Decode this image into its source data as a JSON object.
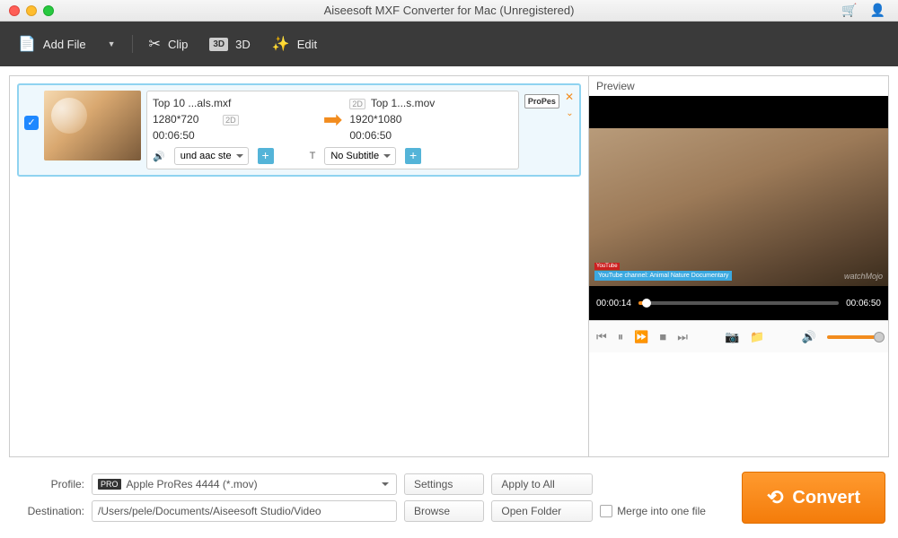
{
  "window": {
    "title": "Aiseesoft MXF Converter for Mac (Unregistered)"
  },
  "toolbar": {
    "add_file": "Add File",
    "clip": "Clip",
    "three_d": "3D",
    "three_d_badge": "3D",
    "edit": "Edit"
  },
  "file": {
    "source": {
      "name": "Top 10 ...als.mxf",
      "dims": "1280*720",
      "dur": "00:06:50",
      "badge": "2D"
    },
    "target": {
      "name": "Top 1...s.mov",
      "dims": "1920*1080",
      "dur": "00:06:50",
      "badge": "2D"
    },
    "audio_sel": "und aac ste",
    "subtitle_sel": "No Subtitle",
    "format_badge": "ProPes"
  },
  "preview": {
    "label": "Preview",
    "current": "00:00:14",
    "total": "00:06:50",
    "banner": "YouTube channel: Animal Nature Documentary",
    "watermark": "watchMojo"
  },
  "bottom": {
    "profile_label": "Profile:",
    "profile_value": "Apple ProRes 4444 (*.mov)",
    "settings": "Settings",
    "apply_all": "Apply to All",
    "dest_label": "Destination:",
    "dest_value": "/Users/pele/Documents/Aiseesoft Studio/Video",
    "browse": "Browse",
    "open_folder": "Open Folder",
    "merge": "Merge into one file",
    "convert": "Convert"
  }
}
